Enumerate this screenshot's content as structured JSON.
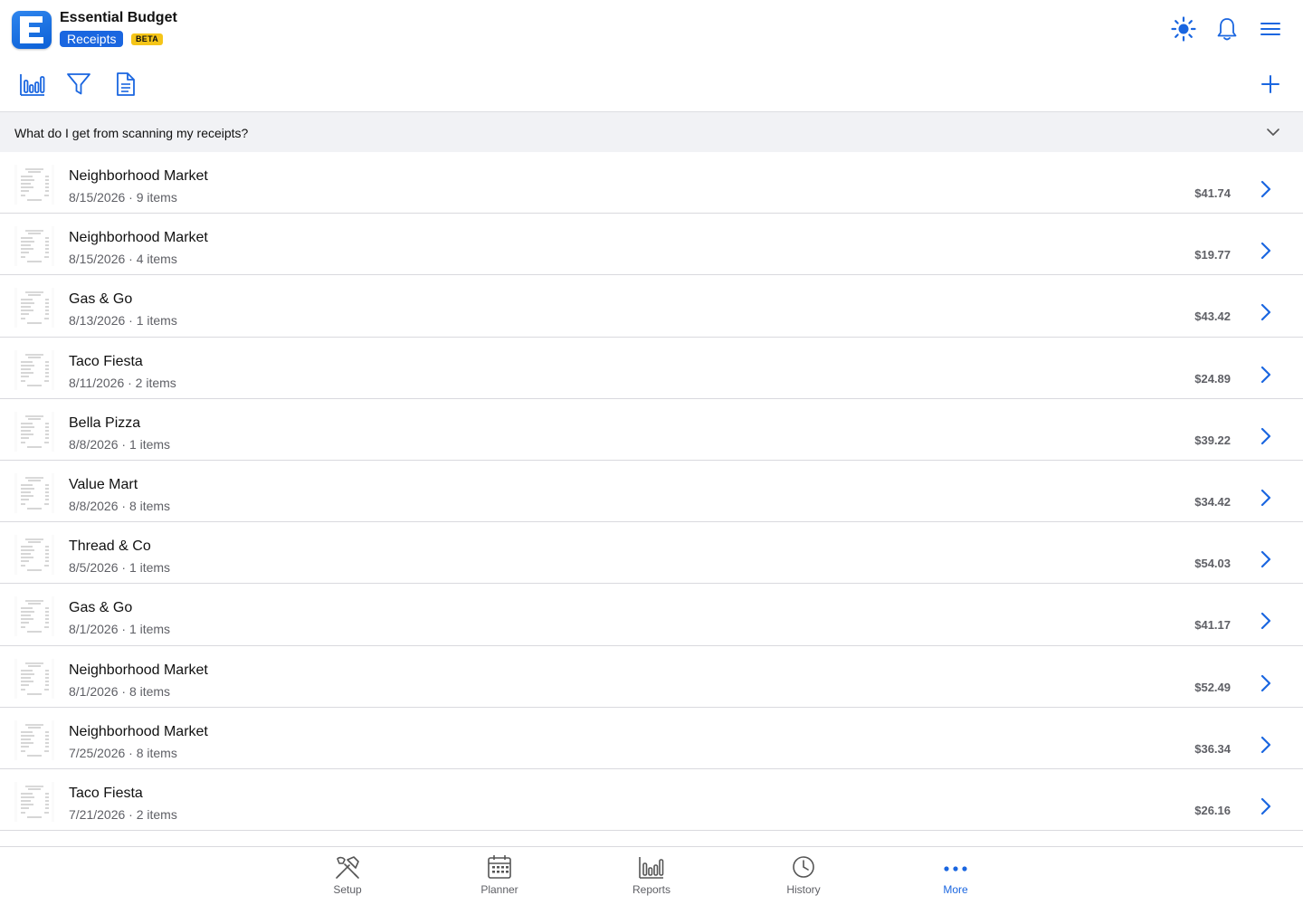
{
  "app": {
    "title": "Essential Budget",
    "section": "Receipts",
    "badge": "BETA"
  },
  "colors": {
    "accent": "#1a66e0",
    "beta_badge": "#f5c518",
    "muted_text": "#5f6066"
  },
  "header_icons": [
    "sun-icon",
    "bell-icon",
    "menu-icon"
  ],
  "toolbar_icons": [
    "reports-chart-icon",
    "filter-icon",
    "document-icon",
    "plus-icon"
  ],
  "faq": {
    "question": "What do I get from scanning my receipts?"
  },
  "receipts": [
    {
      "merchant": "Neighborhood Market",
      "meta": "8/15/2026 · 9 items",
      "amount": "$41.74"
    },
    {
      "merchant": "Neighborhood Market",
      "meta": "8/15/2026 · 4 items",
      "amount": "$19.77"
    },
    {
      "merchant": "Gas & Go",
      "meta": "8/13/2026 · 1 items",
      "amount": "$43.42"
    },
    {
      "merchant": "Taco Fiesta",
      "meta": "8/11/2026 · 2 items",
      "amount": "$24.89"
    },
    {
      "merchant": "Bella Pizza",
      "meta": "8/8/2026 · 1 items",
      "amount": "$39.22"
    },
    {
      "merchant": "Value Mart",
      "meta": "8/8/2026 · 8 items",
      "amount": "$34.42"
    },
    {
      "merchant": "Thread & Co",
      "meta": "8/5/2026 · 1 items",
      "amount": "$54.03"
    },
    {
      "merchant": "Gas & Go",
      "meta": "8/1/2026 · 1 items",
      "amount": "$41.17"
    },
    {
      "merchant": "Neighborhood Market",
      "meta": "8/1/2026 · 8 items",
      "amount": "$52.49"
    },
    {
      "merchant": "Neighborhood Market",
      "meta": "7/25/2026 · 8 items",
      "amount": "$36.34"
    },
    {
      "merchant": "Taco Fiesta",
      "meta": "7/21/2026 · 2 items",
      "amount": "$26.16"
    }
  ],
  "tabs": [
    {
      "label": "Setup",
      "icon": "tools-icon",
      "active": false
    },
    {
      "label": "Planner",
      "icon": "calendar-icon",
      "active": false
    },
    {
      "label": "Reports",
      "icon": "bar-chart-icon",
      "active": false
    },
    {
      "label": "History",
      "icon": "clock-icon",
      "active": false
    },
    {
      "label": "More",
      "icon": "more-dots-icon",
      "active": true
    }
  ]
}
